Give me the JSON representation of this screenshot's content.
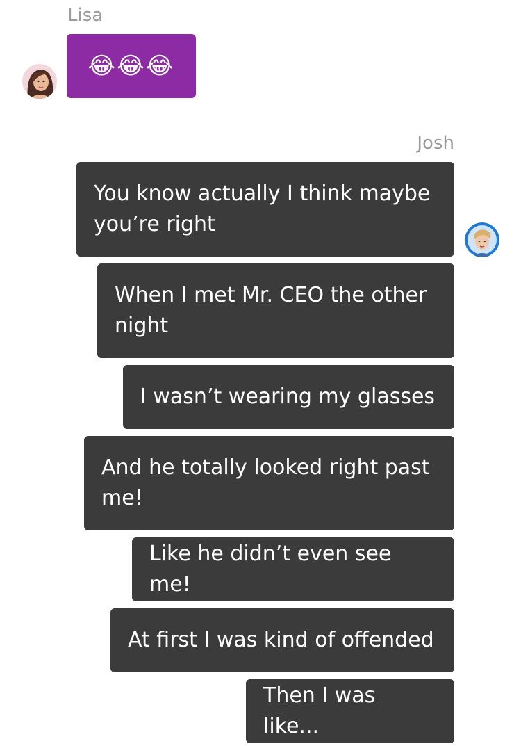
{
  "messages_lisa": {
    "sender": "Lisa",
    "items": [
      {
        "text": "😂😂😂"
      }
    ]
  },
  "messages_josh": {
    "sender": "Josh",
    "items": [
      {
        "text": "You know actually I think maybe you’re right"
      },
      {
        "text": "When I met Mr. CEO the other night"
      },
      {
        "text": "I wasn’t wearing my glasses"
      },
      {
        "text": "And he totally looked right past me!"
      },
      {
        "text": "Like he didn’t even see me!"
      },
      {
        "text": "At first I was kind of offended"
      },
      {
        "text": "Then I was like..."
      }
    ]
  },
  "colors": {
    "lisa_bubble": "#8d2ba5",
    "josh_bubble": "#3b3b3b",
    "sender_name": "#9b9b9b"
  },
  "icons": {
    "lisa_avatar": "lisa-avatar-icon",
    "josh_avatar": "josh-avatar-icon"
  }
}
